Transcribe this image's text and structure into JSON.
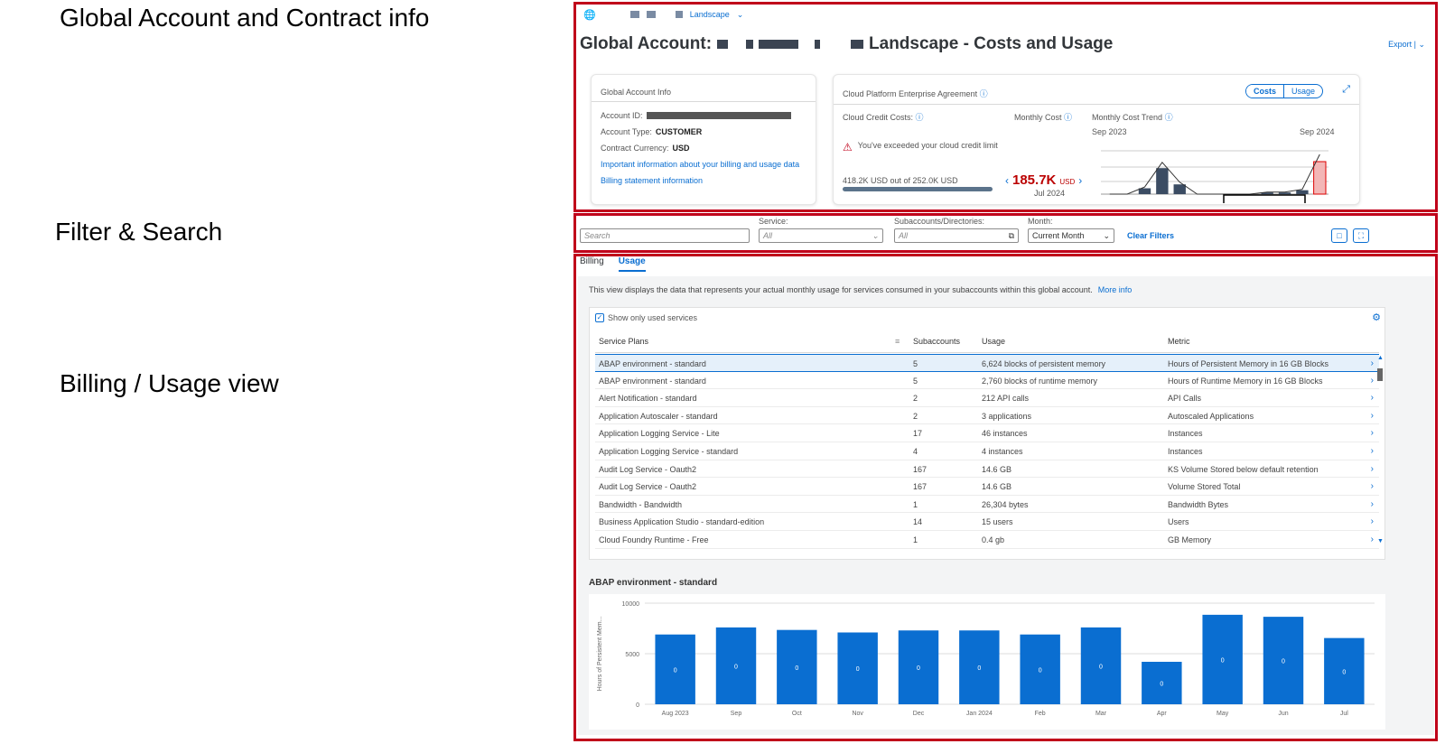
{
  "annotations": {
    "global": "Global Account and Contract info",
    "filter": "Filter & Search",
    "billing": "Billing / Usage view"
  },
  "header": {
    "crumb": "Landscape",
    "title_prefix": "Global Account:",
    "title_suffix": "Landscape - Costs and Usage",
    "export": "Export |"
  },
  "account_info": {
    "heading": "Global Account Info",
    "account_id_label": "Account ID:",
    "account_type_label": "Account Type:",
    "account_type": "CUSTOMER",
    "currency_label": "Contract Currency:",
    "currency": "USD",
    "link1": "Important information about your billing and usage data",
    "link2": "Billing statement information"
  },
  "agreement": {
    "heading": "Cloud Platform Enterprise Agreement",
    "toggle_costs": "Costs",
    "toggle_usage": "Usage",
    "credit_label": "Cloud Credit Costs:",
    "monthly_cost_label": "Monthly Cost",
    "trend_label": "Monthly Cost Trend",
    "trend_start": "Sep 2023",
    "trend_end": "Sep 2024",
    "warning": "You've exceeded your cloud credit limit",
    "credit_usage": "418.2K USD out of 252.0K USD",
    "credit_fraction": 1.0,
    "cost_value": "185.7K",
    "cost_unit": "USD",
    "cost_month": "Jul 2024",
    "trend_values": [
      0,
      0,
      0.18,
      0.8,
      0.3,
      0,
      0,
      0,
      0,
      0.05,
      0.05,
      0.12,
      1.0
    ]
  },
  "filters": {
    "search_placeholder": "Search",
    "service_label": "Service:",
    "service_value": "All",
    "subaccounts_label": "Subaccounts/Directories:",
    "subaccounts_value": "All",
    "month_label": "Month:",
    "month_value": "Current Month",
    "clear": "Clear Filters"
  },
  "tabs": [
    "Billing",
    "Usage"
  ],
  "usage_view": {
    "description": "This view displays the data that represents your actual monthly usage for services consumed in your subaccounts within this global account.",
    "more_info": "More info",
    "show_only_used": "Show only used services",
    "columns": [
      "Service Plans",
      "Subaccounts",
      "Usage",
      "Metric"
    ],
    "rows": [
      {
        "plan": "ABAP environment - standard",
        "subaccounts": "5",
        "usage": "6,624 blocks of persistent memory",
        "metric": "Hours of Persistent Memory in 16 GB Blocks"
      },
      {
        "plan": "ABAP environment - standard",
        "subaccounts": "5",
        "usage": "2,760 blocks of runtime memory",
        "metric": "Hours of Runtime Memory in 16 GB Blocks"
      },
      {
        "plan": "Alert Notification - standard",
        "subaccounts": "2",
        "usage": "212 API calls",
        "metric": "API Calls"
      },
      {
        "plan": "Application Autoscaler - standard",
        "subaccounts": "2",
        "usage": "3 applications",
        "metric": "Autoscaled Applications"
      },
      {
        "plan": "Application Logging Service - Lite",
        "subaccounts": "17",
        "usage": "46 instances",
        "metric": "Instances"
      },
      {
        "plan": "Application Logging Service - standard",
        "subaccounts": "4",
        "usage": "4 instances",
        "metric": "Instances"
      },
      {
        "plan": "Audit Log Service - Oauth2",
        "subaccounts": "167",
        "usage": "14.6 GB",
        "metric": "KS Volume Stored below default retention"
      },
      {
        "plan": "Audit Log Service - Oauth2",
        "subaccounts": "167",
        "usage": "14.6 GB",
        "metric": "Volume Stored Total"
      },
      {
        "plan": "Bandwidth - Bandwidth",
        "subaccounts": "1",
        "usage": "26,304 bytes",
        "metric": "Bandwidth Bytes"
      },
      {
        "plan": "Business Application Studio - standard-edition",
        "subaccounts": "14",
        "usage": "15 users",
        "metric": "Users"
      },
      {
        "plan": "Cloud Foundry Runtime - Free",
        "subaccounts": "1",
        "usage": "0.4 gb",
        "metric": "GB Memory"
      }
    ]
  },
  "chart_data": {
    "type": "bar",
    "title": "ABAP environment - standard",
    "ylabel": "Hours of Persistent Mem...",
    "ylim": [
      0,
      10000
    ],
    "yticks": [
      "0",
      "5000",
      "10000"
    ],
    "categories": [
      "Aug 2023",
      "Sep",
      "Oct",
      "Nov",
      "Dec",
      "Jan 2024",
      "Feb",
      "Mar",
      "Apr",
      "May",
      "Jun",
      "Jul"
    ],
    "values": [
      6900,
      7600,
      7350,
      7100,
      7300,
      7300,
      6900,
      7600,
      4200,
      8850,
      8650,
      6550
    ],
    "labels": [
      "0",
      "0",
      "0",
      "0",
      "0",
      "0",
      "0",
      "0",
      "0",
      "0",
      "0",
      "0"
    ],
    "color": "#0a6ed1",
    "grid": true
  }
}
